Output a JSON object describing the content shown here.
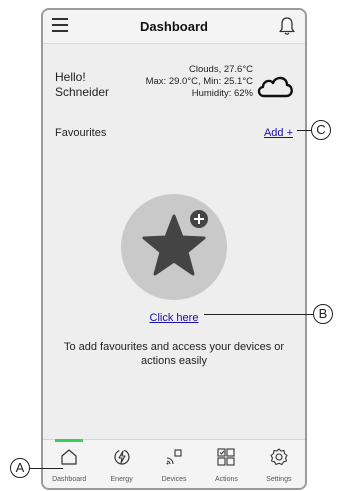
{
  "header": {
    "title": "Dashboard",
    "menu_icon": "hamburger-icon",
    "notification_icon": "bell-icon"
  },
  "greeting": {
    "line1": "Hello!",
    "line2": "Schneider"
  },
  "weather": {
    "condition": "Clouds, 27.6°C",
    "minmax": "Max: 29.0°C, Min: 25.1°C",
    "humidity": "Humidity: 62%",
    "icon": "cloud-icon"
  },
  "favourites": {
    "label": "Favourites",
    "add_label": "Add +",
    "empty_icon": "star-add-icon",
    "click_here": "Click here",
    "description": "To add favourites and access your devices or actions easily"
  },
  "bottom_nav": {
    "items": [
      {
        "label": "Dashboard",
        "icon": "home-icon",
        "active": true
      },
      {
        "label": "Energy",
        "icon": "energy-icon",
        "active": false
      },
      {
        "label": "Devices",
        "icon": "devices-icon",
        "active": false
      },
      {
        "label": "Actions",
        "icon": "actions-icon",
        "active": false
      },
      {
        "label": "Settings",
        "icon": "settings-icon",
        "active": false
      }
    ]
  },
  "callouts": {
    "a": "A",
    "b": "B",
    "c": "C"
  },
  "colors": {
    "accent_green": "#3dcd58",
    "link_blue": "#1a0dab",
    "background": "#eeeeee"
  }
}
